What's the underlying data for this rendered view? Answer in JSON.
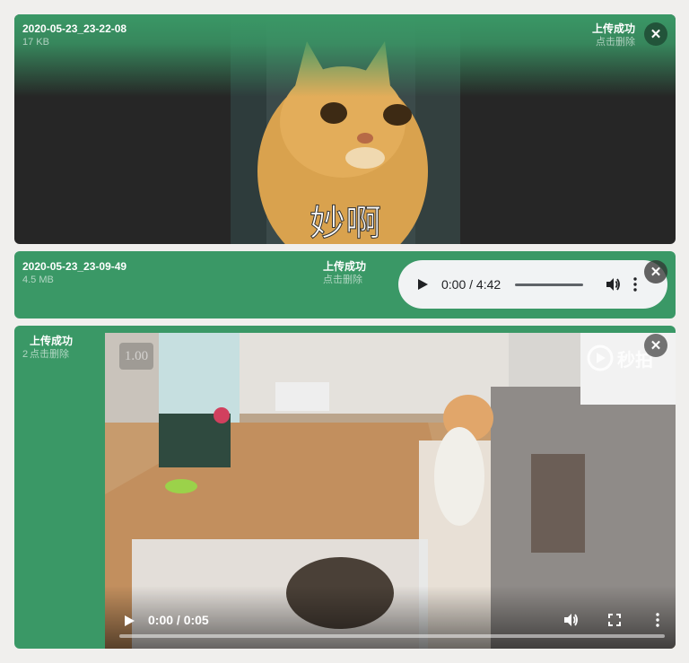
{
  "items": [
    {
      "filename": "2020-05-23_23-22-08",
      "size": "17 KB",
      "status": "上传成功",
      "action": "点击删除",
      "caption": "妙啊"
    },
    {
      "filename": "2020-05-23_23-09-49",
      "size": "4.5 MB",
      "status": "上传成功",
      "action": "点击删除",
      "player": {
        "time": "0:00 / 4:42"
      }
    },
    {
      "status": "上传成功",
      "size_partial": "2",
      "action": "点击删除",
      "player": {
        "time": "0:00 / 0:05",
        "speed": "1.00",
        "watermark": "秒拍"
      }
    }
  ],
  "colors": {
    "success": "#3a9866",
    "close_bg": "rgba(40,40,40,0.85)",
    "player_bg": "#f1f3f4"
  },
  "icons": [
    "close-icon",
    "play-icon",
    "volume-icon",
    "more-icon",
    "fullscreen-icon"
  ]
}
